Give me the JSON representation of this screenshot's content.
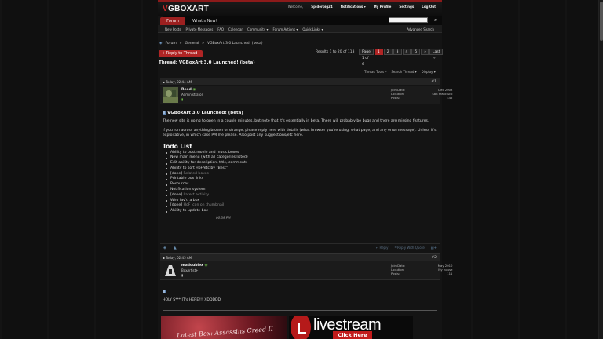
{
  "header": {
    "logo_prefix": "V",
    "logo_text": "GBOXART",
    "user_nav": [
      "Welcome,",
      "Spiderpig24",
      "Notifications ▾",
      "My Profile",
      "Settings",
      "Log Out"
    ],
    "forum_tab": "Forum",
    "whats_new": "What's New?",
    "search_placeholder": "",
    "subnav": [
      "New Posts",
      "Private Messages",
      "FAQ",
      "Calendar",
      "Community ▾",
      "Forum Actions ▾",
      "Quick Links ▾"
    ],
    "advanced_search": "Advanced Search"
  },
  "breadcrumb": [
    "Forum",
    "General",
    "VGBoxArt 3.0 Launched! (beta)"
  ],
  "reply_label": "+ Reply to Thread",
  "results_text": "Results 1 to 20 of 113",
  "pager": [
    "Page 1 of 6",
    "1",
    "2",
    "3",
    "4",
    "5",
    "›",
    "Last ››"
  ],
  "thread_title": "Thread: VGBoxArt 3.0 Launched! (beta)",
  "thread_tools": [
    "Thread Tools ▾",
    "Search Thread ▾",
    "Display ▾"
  ],
  "post1": {
    "date": "Today,   02:44 AM",
    "number": "#1",
    "username": "Reed",
    "rank": "Administrator",
    "stats_labels": [
      "Join Date:",
      "Location:",
      "Posts:"
    ],
    "stats_values": [
      "Dec 2003",
      "San Francisco",
      "445"
    ],
    "title": "VGBoxArt 3.0 Launched! (beta)",
    "para1": "The new site is going to open in a couple minutes, but note that it's essentially in beta. There will probably be bugs and there are missing features.",
    "para2": "If you run across anything broken or strange, please reply here with details (what browser you're using, what page, and any error message). Unless it's exploitative, in which case PM me please. Also post any suggestions/etc here.",
    "todo_heading": "Todo List",
    "todo": [
      {
        "text": "Ability to post movie and music boxes",
        "done": ""
      },
      {
        "text": "New main menu (with all categories listed)",
        "done": ""
      },
      {
        "text": "Edit ability for description, title, comments",
        "done": ""
      },
      {
        "text": "Ability to sort HoF/etc by \"Best\"",
        "done": ""
      },
      {
        "text": "Related boxes",
        "done": "[done] "
      },
      {
        "text": "Printable box links",
        "done": ""
      },
      {
        "text": "Resources",
        "done": ""
      },
      {
        "text": "Notification system",
        "done": ""
      },
      {
        "text": "Latest activity",
        "done": "[done] "
      },
      {
        "text": "Who fav'd a box",
        "done": ""
      },
      {
        "text": "HoF icon on thumbnail",
        "done": "[done] "
      },
      {
        "text": "Ability to update box",
        "done": ""
      }
    ],
    "edited_time": "06:39 PM",
    "actions_right": [
      "Reply",
      "Reply With Quote"
    ]
  },
  "post2": {
    "date": "Today,   02:45 AM",
    "number": "#2",
    "username": "madoublex",
    "rank": "BoxArtist+",
    "stats_labels": [
      "Join Date:",
      "Location:",
      "Posts:"
    ],
    "stats_values": [
      "May 2010",
      "My house",
      "111"
    ],
    "text": "HOLY S*** IT's HERE!!! XDDDDD"
  },
  "banners": {
    "left_text": "Latest Box: Assassins Creed II",
    "right_text": "livestream",
    "right_button": "Click Here"
  }
}
